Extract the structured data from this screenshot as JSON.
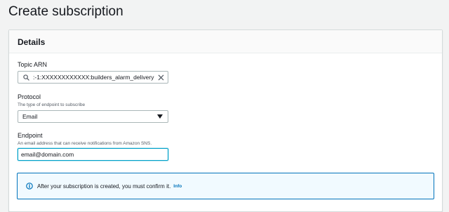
{
  "page": {
    "title": "Create subscription"
  },
  "details": {
    "title": "Details",
    "topic_arn": {
      "label": "Topic ARN",
      "value": ":-1:XXXXXXXXXXXX:builders_alarm_delivery",
      "icon": "search-icon",
      "clear_icon": "close-icon"
    },
    "protocol": {
      "label": "Protocol",
      "description": "The type of endpoint to subscribe",
      "selected": "Email",
      "icon": "caret-down-icon"
    },
    "endpoint": {
      "label": "Endpoint",
      "description": "An email address that can receive notifications from Amazon SNS.",
      "value": "email@domain.com"
    },
    "alert": {
      "message": "After your subscription is created, you must confirm it.",
      "link": "Info",
      "icon": "info-icon"
    }
  },
  "colors": {
    "background": "#f2f3f3",
    "focus_border": "#00a1c9",
    "info_border": "#0073bb",
    "info_background": "#f1faff",
    "link": "#0073bb"
  }
}
